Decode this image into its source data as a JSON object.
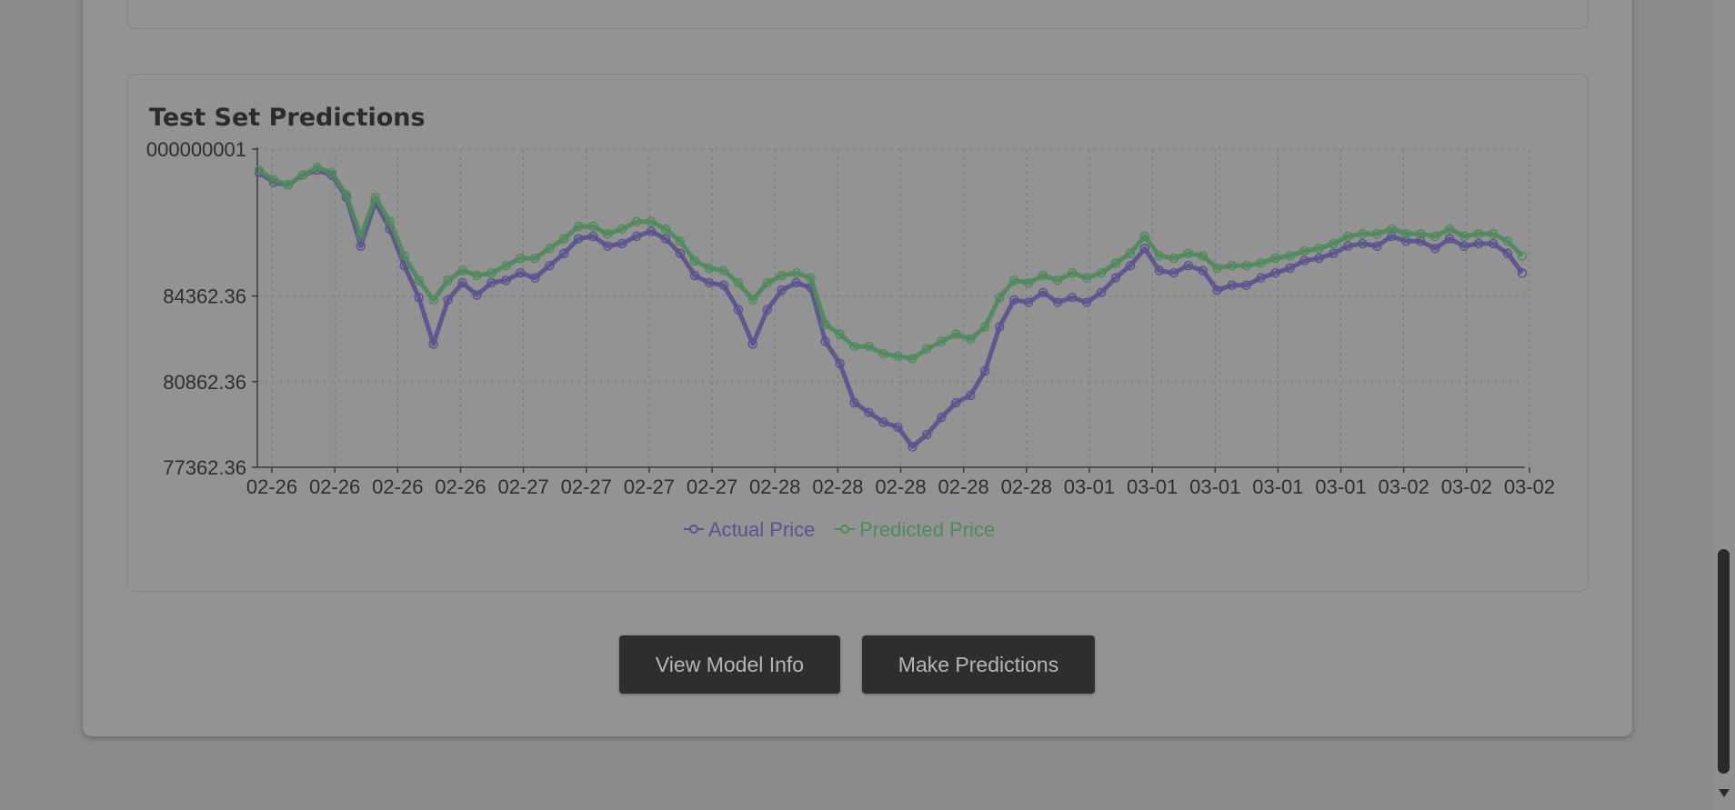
{
  "panel": {
    "title": "Test Set Predictions"
  },
  "buttons": {
    "view_model_info": "View Model Info",
    "make_predictions": "Make Predictions"
  },
  "chart_data": {
    "type": "line",
    "title": "Test Set Predictions",
    "xlabel": "",
    "ylabel": "",
    "y_tick_labels": [
      "77362.36",
      "80862.36",
      "84362.36",
      "000000001"
    ],
    "x_tick_labels": [
      "02-26",
      "02-26",
      "02-26",
      "02-26",
      "02-27",
      "02-27",
      "02-27",
      "02-27",
      "02-28",
      "02-28",
      "02-28",
      "02-28",
      "02-28",
      "03-01",
      "03-01",
      "03-01",
      "03-01",
      "03-01",
      "03-02",
      "03-02",
      "03-02"
    ],
    "ylim": [
      77362.36,
      90362.36
    ],
    "grid": true,
    "legend_position": "bottom",
    "series": [
      {
        "name": "Actual Price",
        "color": "#5a5290",
        "values": [
          89400,
          89000,
          88900,
          89300,
          89500,
          89300,
          88400,
          86400,
          88200,
          87100,
          85600,
          84300,
          82400,
          84200,
          84900,
          84400,
          84900,
          85000,
          85300,
          85100,
          85600,
          86100,
          86700,
          86800,
          86400,
          86500,
          86800,
          87000,
          86700,
          86100,
          85200,
          84900,
          84800,
          83800,
          82400,
          83800,
          84600,
          84900,
          84700,
          82500,
          81600,
          80000,
          79600,
          79200,
          79000,
          78200,
          78700,
          79400,
          80000,
          80300,
          81300,
          83100,
          84200,
          84100,
          84500,
          84100,
          84300,
          84100,
          84500,
          85100,
          85600,
          86300,
          85400,
          85300,
          85600,
          85400,
          84600,
          84800,
          84800,
          85100,
          85300,
          85500,
          85800,
          85900,
          86100,
          86400,
          86500,
          86400,
          86800,
          86600,
          86600,
          86300,
          86700,
          86400,
          86500,
          86500,
          86100,
          85300
        ]
      },
      {
        "name": "Predicted Price",
        "color": "#4e8a5a",
        "values": [
          89500,
          89100,
          88900,
          89300,
          89600,
          89400,
          88500,
          86800,
          88400,
          87400,
          86000,
          85000,
          84200,
          85000,
          85400,
          85200,
          85300,
          85600,
          85900,
          85900,
          86300,
          86700,
          87200,
          87200,
          86900,
          87100,
          87400,
          87400,
          87100,
          86600,
          85800,
          85500,
          85400,
          84900,
          84200,
          84900,
          85200,
          85300,
          85100,
          83200,
          82800,
          82300,
          82300,
          82000,
          81900,
          81800,
          82200,
          82500,
          82800,
          82600,
          83100,
          84300,
          85000,
          84900,
          85200,
          85000,
          85300,
          85100,
          85300,
          85700,
          86100,
          86800,
          86000,
          85900,
          86100,
          86000,
          85500,
          85600,
          85600,
          85700,
          85900,
          86000,
          86200,
          86300,
          86500,
          86800,
          86900,
          86900,
          87100,
          86900,
          86900,
          86800,
          87100,
          86800,
          86900,
          86900,
          86600,
          86000
        ]
      }
    ]
  }
}
